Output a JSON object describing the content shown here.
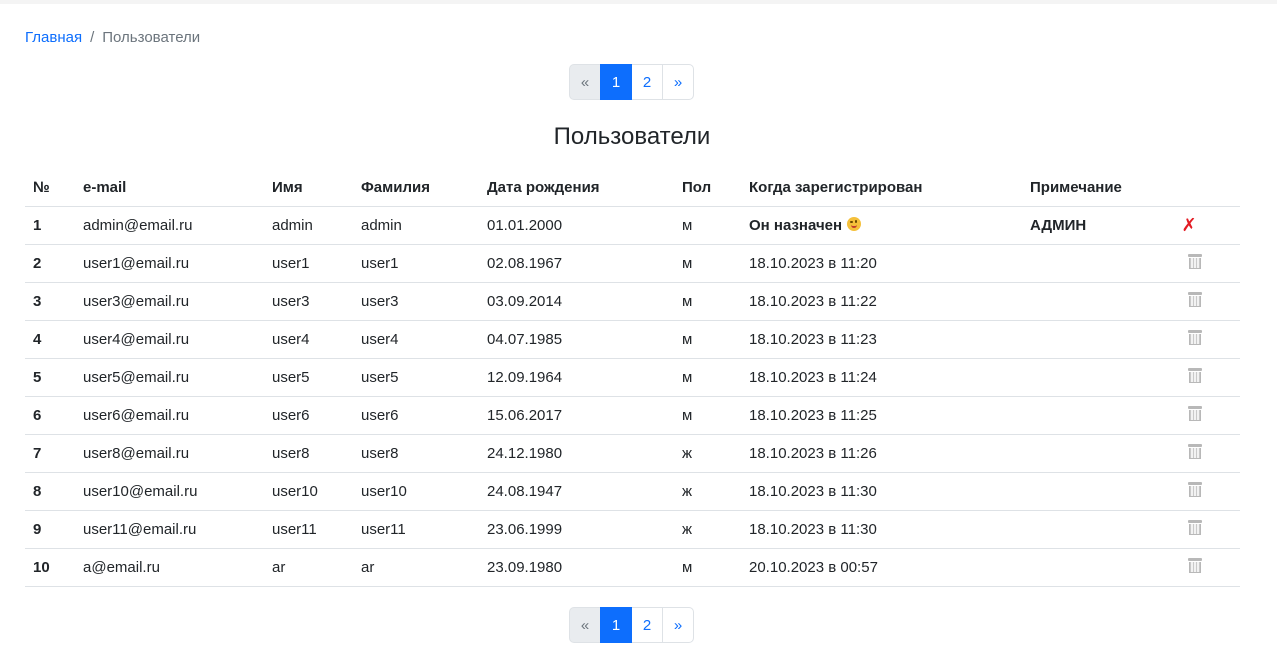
{
  "breadcrumb": {
    "home": "Главная",
    "separator": "/",
    "current": "Пользователи"
  },
  "pagination": {
    "prev": "«",
    "pages": [
      "1",
      "2"
    ],
    "active_page": "1",
    "next": "»"
  },
  "title": "Пользователи",
  "table": {
    "headers": [
      "№",
      "e-mail",
      "Имя",
      "Фамилия",
      "Дата рождения",
      "Пол",
      "Когда зарегистрирован",
      "Примечание"
    ],
    "rows": [
      {
        "num": "1",
        "email": "admin@email.ru",
        "name": "admin",
        "surname": "admin",
        "dob": "01.01.2000",
        "sex": "м",
        "registered": "Он назначен",
        "note": "АДМИН",
        "action_icon": "x-icon"
      },
      {
        "num": "2",
        "email": "user1@email.ru",
        "name": "user1",
        "surname": "user1",
        "dob": "02.08.1967",
        "sex": "м",
        "registered": "18.10.2023 в 11:20",
        "note": "",
        "action_icon": "trash-icon"
      },
      {
        "num": "3",
        "email": "user3@email.ru",
        "name": "user3",
        "surname": "user3",
        "dob": "03.09.2014",
        "sex": "м",
        "registered": "18.10.2023 в 11:22",
        "note": "",
        "action_icon": "trash-icon"
      },
      {
        "num": "4",
        "email": "user4@email.ru",
        "name": "user4",
        "surname": "user4",
        "dob": "04.07.1985",
        "sex": "м",
        "registered": "18.10.2023 в 11:23",
        "note": "",
        "action_icon": "trash-icon"
      },
      {
        "num": "5",
        "email": "user5@email.ru",
        "name": "user5",
        "surname": "user5",
        "dob": "12.09.1964",
        "sex": "м",
        "registered": "18.10.2023 в 11:24",
        "note": "",
        "action_icon": "trash-icon"
      },
      {
        "num": "6",
        "email": "user6@email.ru",
        "name": "user6",
        "surname": "user6",
        "dob": "15.06.2017",
        "sex": "м",
        "registered": "18.10.2023 в 11:25",
        "note": "",
        "action_icon": "trash-icon"
      },
      {
        "num": "7",
        "email": "user8@email.ru",
        "name": "user8",
        "surname": "user8",
        "dob": "24.12.1980",
        "sex": "ж",
        "registered": "18.10.2023 в 11:26",
        "note": "",
        "action_icon": "trash-icon"
      },
      {
        "num": "8",
        "email": "user10@email.ru",
        "name": "user10",
        "surname": "user10",
        "dob": "24.08.1947",
        "sex": "ж",
        "registered": "18.10.2023 в 11:30",
        "note": "",
        "action_icon": "trash-icon"
      },
      {
        "num": "9",
        "email": "user11@email.ru",
        "name": "user11",
        "surname": "user11",
        "dob": "23.06.1999",
        "sex": "ж",
        "registered": "18.10.2023 в 11:30",
        "note": "",
        "action_icon": "trash-icon"
      },
      {
        "num": "10",
        "email": "a@email.ru",
        "name": "ar",
        "surname": "ar",
        "dob": "23.09.1980",
        "sex": "м",
        "registered": "20.10.2023 в 00:57",
        "note": "",
        "action_icon": "trash-icon"
      }
    ]
  },
  "icons": {
    "delete_disabled": "x-icon",
    "delete": "trash-icon",
    "emoji": "wink-emoji-icon"
  },
  "colors": {
    "link": "#0d6efd",
    "active_page": "#0d6efd",
    "x_mark": "#e31b23"
  }
}
